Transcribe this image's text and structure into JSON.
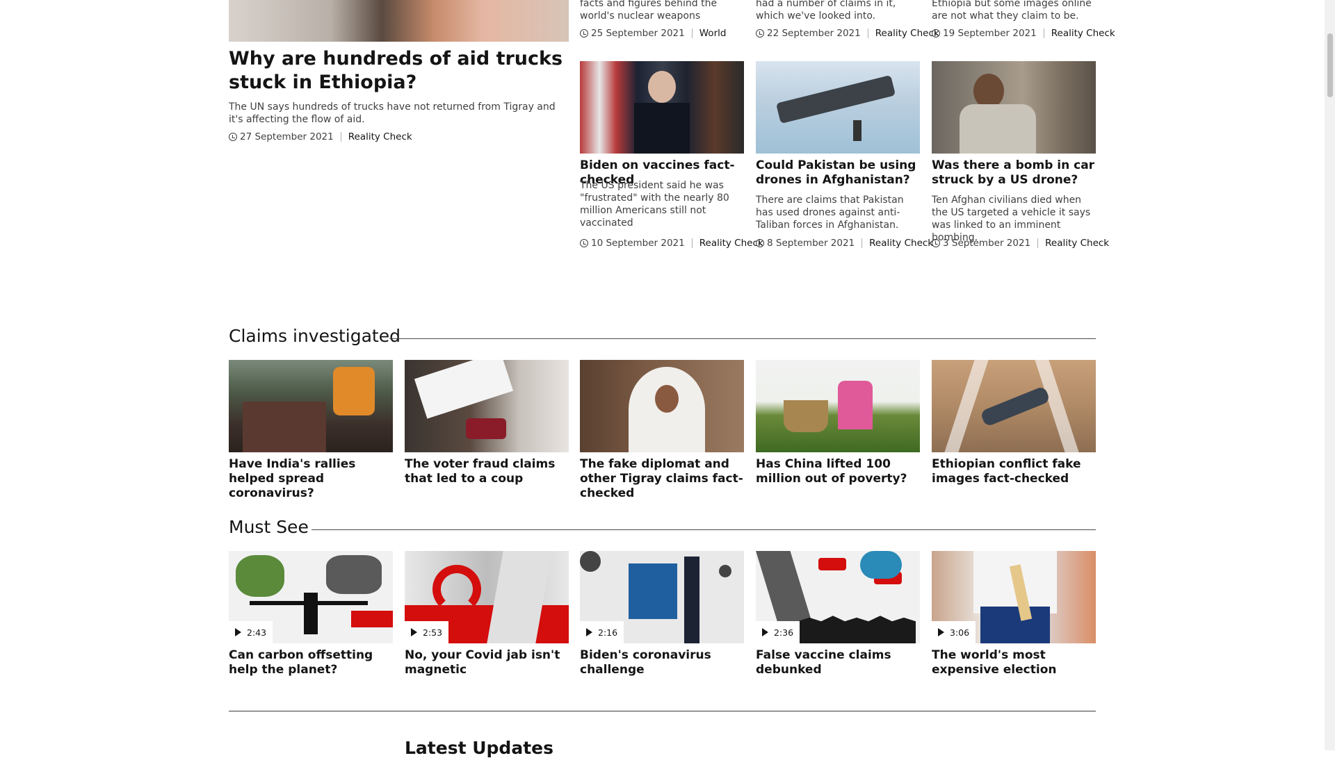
{
  "lead": {
    "title": "Why are hundreds of aid trucks stuck in Ethiopia?",
    "summary": "The UN says hundreds of trucks have not returned from Tigray and it's affecting the flow of aid.",
    "date": "27 September 2021",
    "tag": "Reality Check"
  },
  "top_row": [
    {
      "summary": "facts and figures behind the world's nuclear weapons",
      "date": "25 September 2021",
      "tag": "World"
    },
    {
      "summary": "had a number of claims in it, which we've looked into.",
      "date": "22 September 2021",
      "tag": "Reality Check"
    },
    {
      "summary": "Ethiopia but some images online are not what they claim to be.",
      "date": "19 September 2021",
      "tag": "Reality Check"
    }
  ],
  "grid": [
    {
      "title": "Biden on vaccines fact-checked",
      "summary": "The US president said he was \"frustrated\" with the nearly 80 million Americans still not vaccinated",
      "date": "10 September 2021",
      "tag": "Reality Check"
    },
    {
      "title": "Could Pakistan be using drones in Afghanistan?",
      "summary": "There are claims that Pakistan has used drones against anti-Taliban forces in Afghanistan.",
      "date": "8 September 2021",
      "tag": "Reality Check"
    },
    {
      "title": "Was there a bomb in car struck by a US drone?",
      "summary": "Ten Afghan civilians died when the US targeted a vehicle it says was linked to an imminent bombing.",
      "date": "3 September 2021",
      "tag": "Reality Check"
    }
  ],
  "claims": {
    "heading": "Claims investigated",
    "items": [
      {
        "title": "Have India's rallies helped spread coronavirus?"
      },
      {
        "title": "The voter fraud claims that led to a coup"
      },
      {
        "title": "The fake diplomat and other Tigray claims fact-checked"
      },
      {
        "title": "Has China lifted 100 million out of poverty?"
      },
      {
        "title": "Ethiopian conflict fake images fact-checked"
      }
    ]
  },
  "must_see": {
    "heading": "Must See",
    "items": [
      {
        "title": "Can carbon offsetting help the planet?",
        "duration": "2:43"
      },
      {
        "title": "No, your Covid jab isn't magnetic",
        "duration": "2:53"
      },
      {
        "title": "Biden's coronavirus challenge",
        "duration": "2:16"
      },
      {
        "title": "False vaccine claims debunked",
        "duration": "2:36"
      },
      {
        "title": "The world's most expensive election",
        "duration": "3:06"
      }
    ]
  },
  "latest": {
    "heading": "Latest Updates"
  }
}
